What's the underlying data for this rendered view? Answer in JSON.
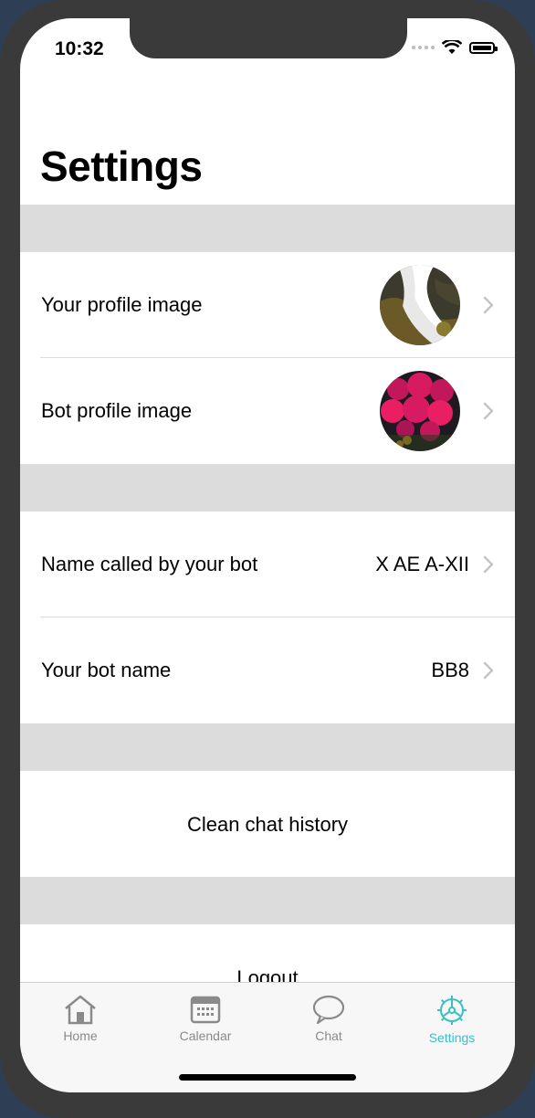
{
  "status_bar": {
    "time": "10:32"
  },
  "page": {
    "title": "Settings"
  },
  "profile_section": [
    {
      "label": "Your profile image"
    },
    {
      "label": "Bot profile image"
    }
  ],
  "name_section": [
    {
      "label": "Name called by your bot",
      "value": "X AE A-XII"
    },
    {
      "label": "Your bot name",
      "value": "BB8"
    }
  ],
  "actions": {
    "clean_chat": "Clean chat history",
    "logout": "Logout"
  },
  "tabbar": {
    "tabs": [
      {
        "label": "Home",
        "icon": "house-icon"
      },
      {
        "label": "Calendar",
        "icon": "calendar-icon"
      },
      {
        "label": "Chat",
        "icon": "chat-bubble-icon"
      },
      {
        "label": "Settings",
        "icon": "gear-icon"
      }
    ],
    "active": "Settings",
    "accent_color": "#3bbfc4"
  }
}
